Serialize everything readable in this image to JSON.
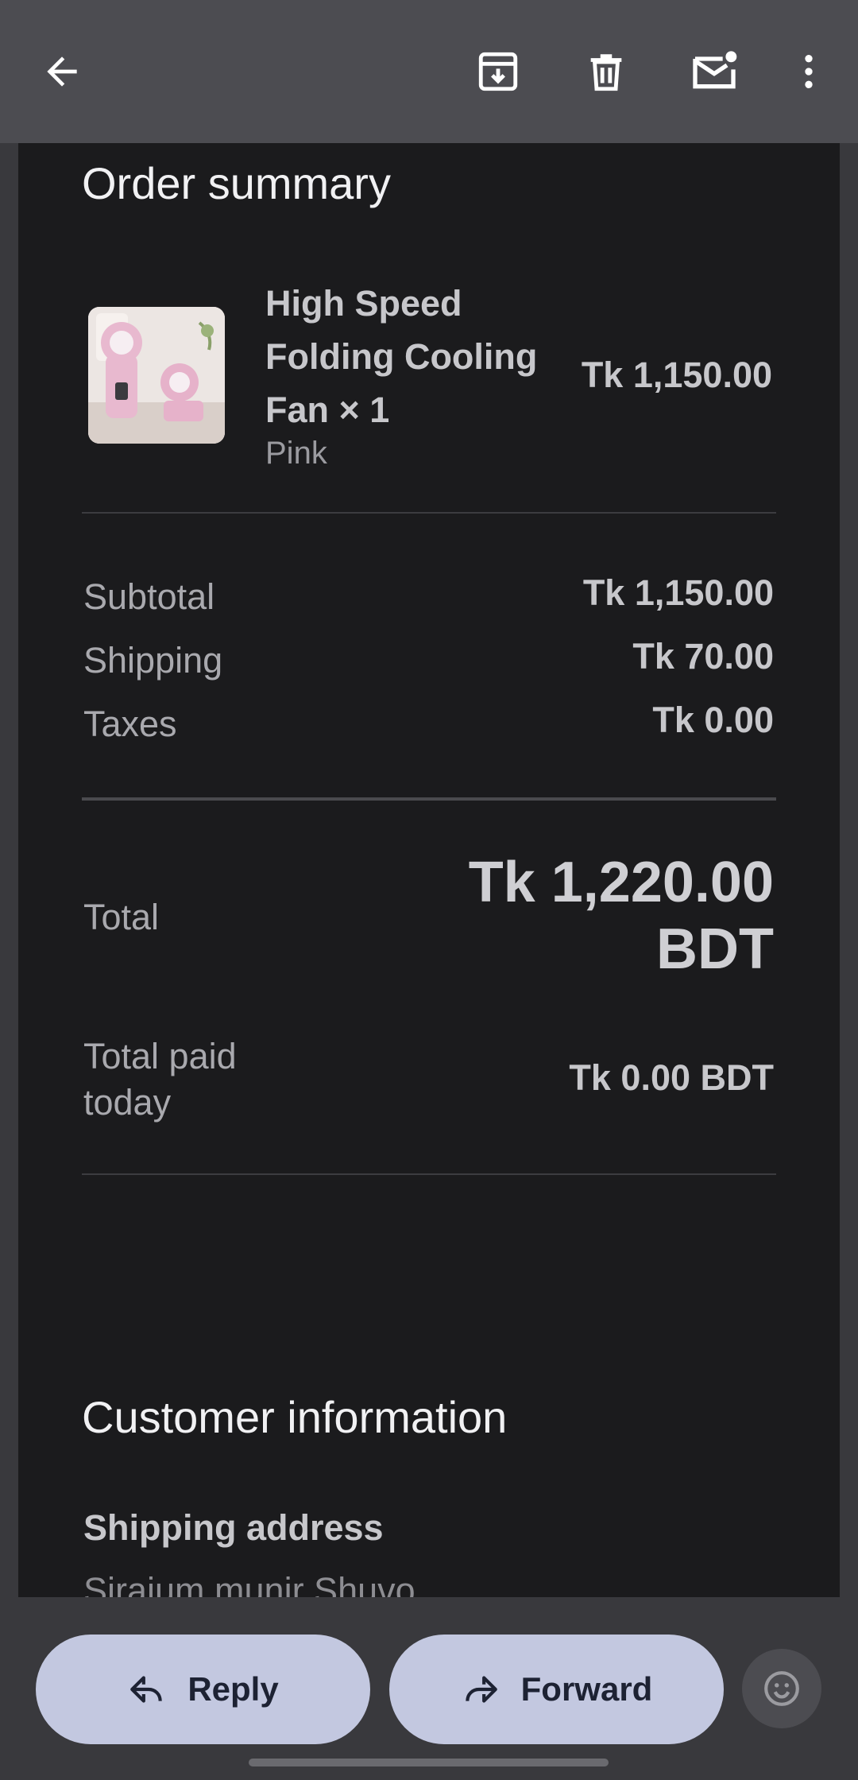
{
  "toolbar": {
    "icons": [
      "back-arrow-icon",
      "archive-icon",
      "delete-icon",
      "mark-unread-icon",
      "more-vert-icon"
    ]
  },
  "order_summary": {
    "title": "Order summary",
    "item": {
      "name": "High Speed Folding Cooling Fan × 1",
      "variant": "Pink",
      "price": "Tk 1,150.00"
    },
    "subtotal_label": "Subtotal",
    "subtotal_value": "Tk 1,150.00",
    "shipping_label": "Shipping",
    "shipping_value": "Tk 70.00",
    "taxes_label": "Taxes",
    "taxes_value": "Tk 0.00",
    "total_label": "Total",
    "total_value": "Tk 1,220.00 BDT",
    "paid_label": "Total paid today",
    "paid_value": "Tk 0.00 BDT"
  },
  "customer": {
    "title": "Customer information",
    "shipping_address_label": "Shipping address",
    "shipping_address_name": "Siraium munir Shuvo"
  },
  "actions": {
    "reply_label": "Reply",
    "forward_label": "Forward"
  },
  "colors": {
    "appbar": "#4c4c51",
    "panel": "#1b1b1d",
    "pill": "#c3c8e0"
  }
}
